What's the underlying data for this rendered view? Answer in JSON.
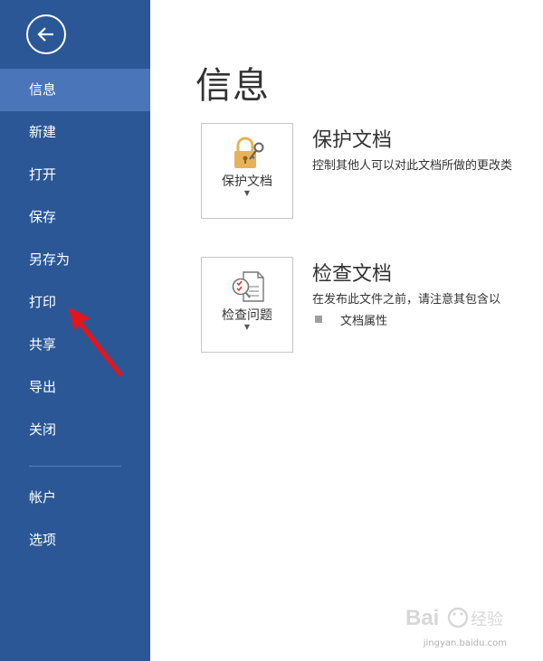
{
  "sidebar": {
    "items": [
      {
        "label": "信息",
        "selected": true
      },
      {
        "label": "新建"
      },
      {
        "label": "打开"
      },
      {
        "label": "保存"
      },
      {
        "label": "另存为"
      },
      {
        "label": "打印"
      },
      {
        "label": "共享"
      },
      {
        "label": "导出"
      },
      {
        "label": "关闭"
      },
      {
        "label": "帐户"
      },
      {
        "label": "选项"
      }
    ],
    "background_color": "#2b5797",
    "selected_color": "#4a75b8",
    "back_icon": "back-arrow-icon"
  },
  "main": {
    "title": "信息",
    "sections": [
      {
        "card_label": "保护文档",
        "title": "保护文档",
        "description": "控制其他人可以对此文档所做的更改类",
        "icon": "lock-key-icon"
      },
      {
        "card_label": "检查问题",
        "title": "检查文档",
        "description": "在发布此文件之前，请注意其包含以",
        "bullet": "文档属性",
        "icon": "inspect-document-icon"
      }
    ]
  },
  "annotation": {
    "color": "#e0161d",
    "icon": "red-arrow-icon"
  },
  "watermark": {
    "text": "jingyan.baidu.com"
  }
}
